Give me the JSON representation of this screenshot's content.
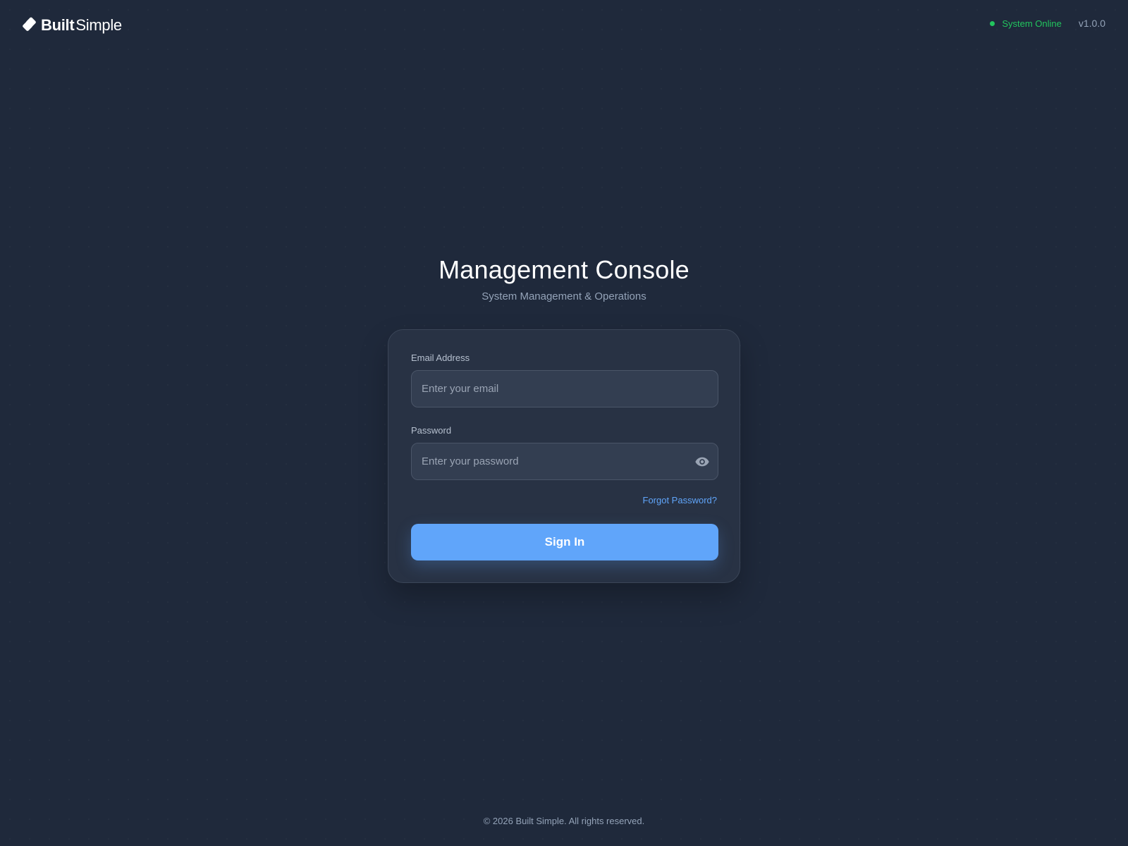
{
  "header": {
    "logo": {
      "bold": "Built",
      "light": "Simple",
      "icon": "diamond-logo-icon"
    },
    "status": {
      "text": "System Online",
      "color": "#22c55e"
    },
    "version": "v1.0.0"
  },
  "main": {
    "title": "Management Console",
    "subtitle": "System Management & Operations"
  },
  "form": {
    "email": {
      "label": "Email Address",
      "placeholder": "Enter your email",
      "value": ""
    },
    "password": {
      "label": "Password",
      "placeholder": "Enter your password",
      "value": "",
      "toggle_icon": "eye-icon"
    },
    "forgot_password": "Forgot Password?",
    "sign_in": "Sign In"
  },
  "footer": {
    "copyright": "© 2026 Built Simple. All rights reserved."
  },
  "colors": {
    "accent": "#60a5fa",
    "link": "#60a5fa",
    "status_online": "#22c55e",
    "background": "#1f293b",
    "card": "#283244"
  }
}
